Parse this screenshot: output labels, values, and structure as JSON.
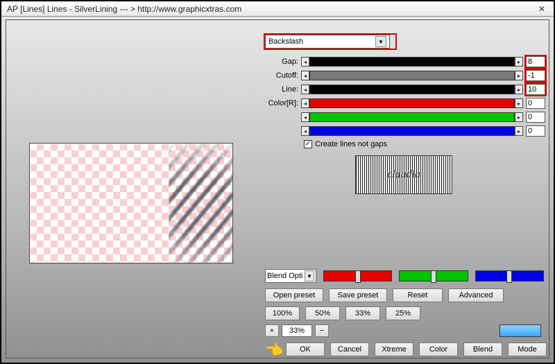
{
  "title": "AP [Lines]  Lines - SilverLining    --- >  http://www.graphicxtras.com",
  "close_glyph": "✕",
  "type_dropdown": {
    "value": "Backslash"
  },
  "sliders": {
    "gap": {
      "label": "Gap:",
      "value": "8"
    },
    "cutoff": {
      "label": "Cutoff:",
      "value": "-1"
    },
    "line": {
      "label": "Line:",
      "value": "10"
    },
    "colorR": {
      "label": "Color[R]:",
      "value": "0"
    },
    "colorG": {
      "label": "",
      "value": "0"
    },
    "colorB": {
      "label": "",
      "value": "0"
    }
  },
  "checkbox": {
    "label": "Create lines not gaps",
    "checked": true
  },
  "logo_text": "claudia",
  "blend_option": "Blend Opti",
  "preset_row": {
    "open": "Open preset",
    "save": "Save preset",
    "reset": "Reset",
    "advanced": "Advanced"
  },
  "zoom_presets": [
    "100%",
    "50%",
    "33%",
    "25%"
  ],
  "zoom": {
    "plus": "+",
    "value": "33%",
    "minus": "−"
  },
  "bottom_row": {
    "ok": "OK",
    "cancel": "Cancel",
    "xtreme": "Xtreme",
    "color": "Color",
    "blend": "Blend",
    "mode": "Mode"
  }
}
